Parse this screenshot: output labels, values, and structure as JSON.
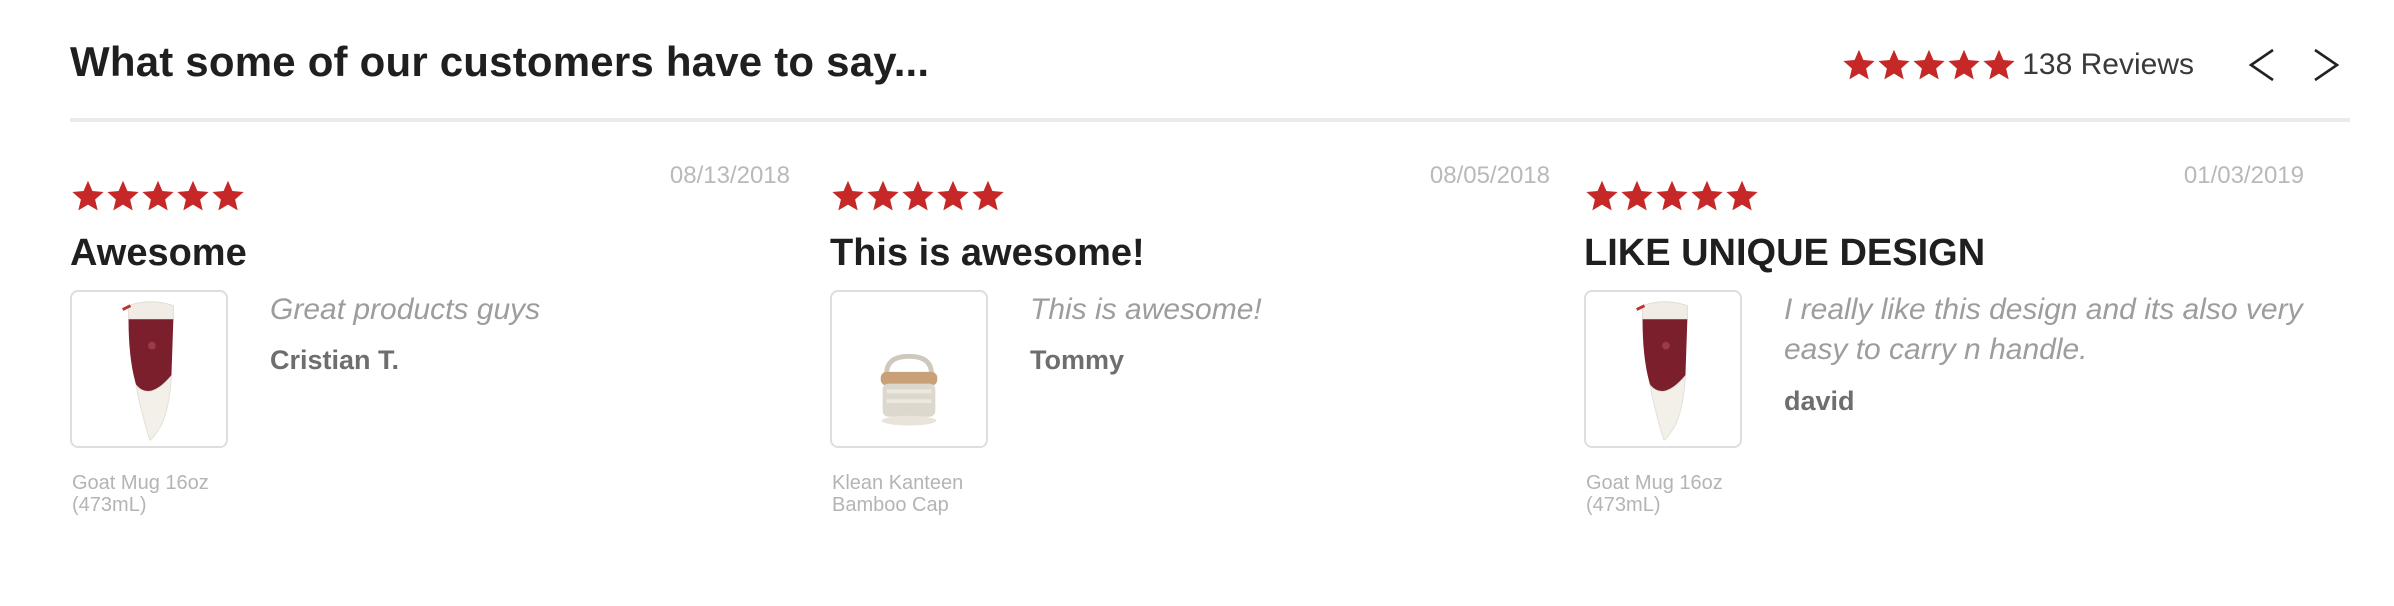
{
  "header": {
    "title": "What some of our customers have to say...",
    "rating_stars": 5,
    "review_count_label": "138 Reviews",
    "prev_icon": "chevron-left-icon",
    "next_icon": "chevron-right-icon"
  },
  "colors": {
    "star": "#c62828",
    "divider": "#ebebeb",
    "muted_text": "#9d9d9d"
  },
  "reviews": [
    {
      "stars": 5,
      "date": "08/13/2018",
      "title": "Awesome",
      "body": "Great products guys",
      "author": "Cristian T.",
      "product_name": "Goat Mug 16oz (473mL)",
      "product_image": "goat-mug-image"
    },
    {
      "stars": 5,
      "date": "08/05/2018",
      "title": "This is awesome!",
      "body": "This is awesome!",
      "author": "Tommy",
      "product_name": "Klean Kanteen Bamboo Cap",
      "product_image": "bamboo-cap-image"
    },
    {
      "stars": 5,
      "date": "01/03/2019",
      "title": "LIKE UNIQUE DESIGN",
      "body": "I really like this design and its also very easy to carry n handle.",
      "author": "david",
      "product_name": "Goat Mug 16oz (473mL)",
      "product_image": "goat-mug-image"
    }
  ]
}
